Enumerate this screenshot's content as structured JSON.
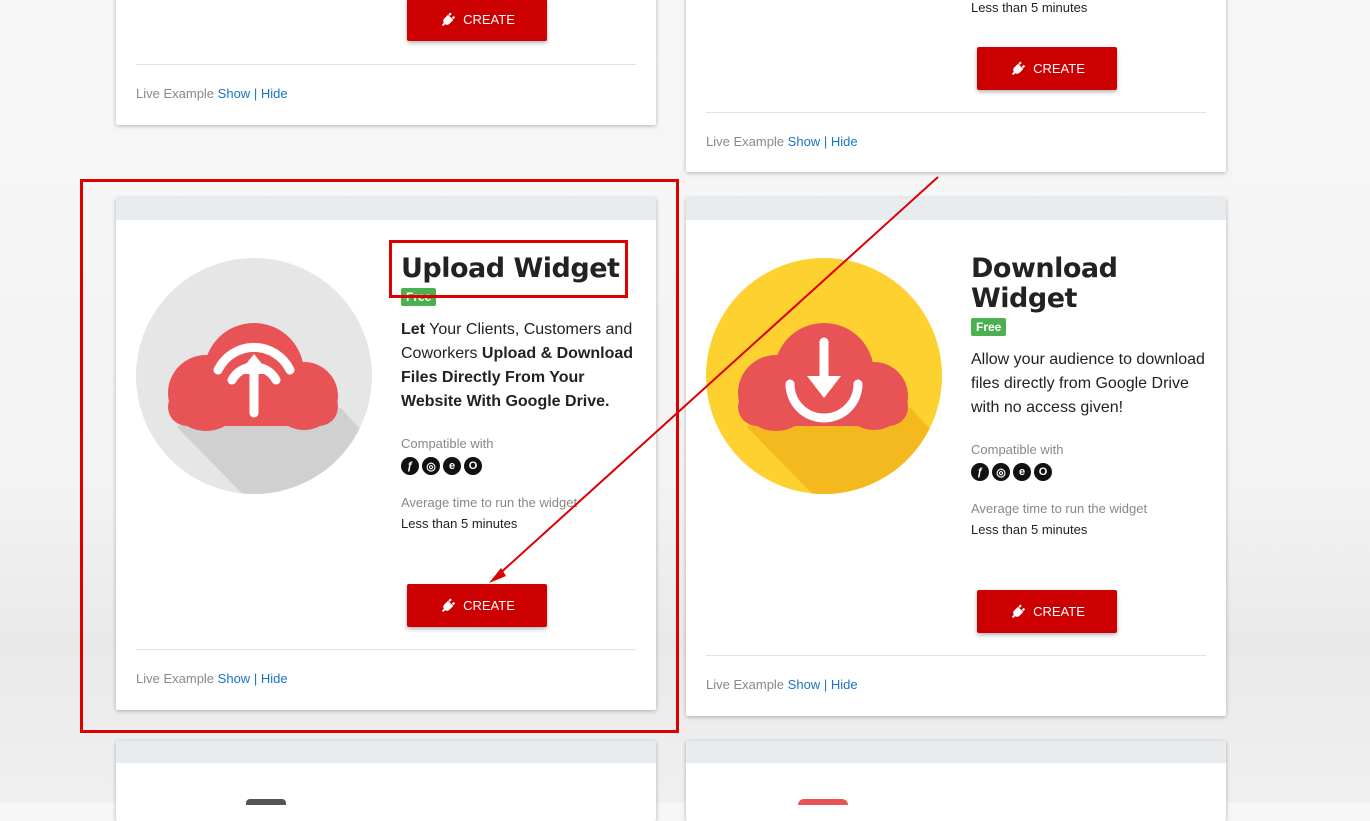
{
  "cards": {
    "top_left": {
      "create_label": "CREATE",
      "live": {
        "prefix": "Live Example",
        "show": "Show",
        "sep": "|",
        "hide": "Hide"
      }
    },
    "top_right": {
      "time_value": "Less than 5 minutes",
      "create_label": "CREATE",
      "live": {
        "prefix": "Live Example",
        "show": "Show",
        "sep": "|",
        "hide": "Hide"
      }
    },
    "upload": {
      "title": "Upload Widget",
      "badge": "Free",
      "desc": {
        "p1": "Let",
        "p2": " Your Clients, Customers and Coworkers ",
        "p3": "Upload & Download Files Directly From Your Website With Google Drive."
      },
      "compat_label": "Compatible with",
      "time_label": "Average time to run the widget",
      "time_value": "Less than 5 minutes",
      "create_label": "CREATE",
      "live": {
        "prefix": "Live Example",
        "show": "Show",
        "sep": "|",
        "hide": "Hide"
      }
    },
    "download": {
      "title": "Download Widget",
      "badge": "Free",
      "desc": "Allow your audience to download files directly from Google Drive with no access given!",
      "compat_label": "Compatible with",
      "time_label": "Average time to run the widget",
      "time_value": "Less than 5 minutes",
      "create_label": "CREATE",
      "live": {
        "prefix": "Live Example",
        "show": "Show",
        "sep": "|",
        "hide": "Hide"
      }
    }
  },
  "browser_icons": [
    "firefox-icon",
    "chrome-icon",
    "edge-icon",
    "opera-icon"
  ],
  "colors": {
    "create_button": "#cc0000",
    "badge_free": "#4caf50",
    "link": "#1a73c9",
    "annotation": "#dd0000",
    "upload_cloud": "#e85456",
    "download_circle": "#fdd12f"
  }
}
